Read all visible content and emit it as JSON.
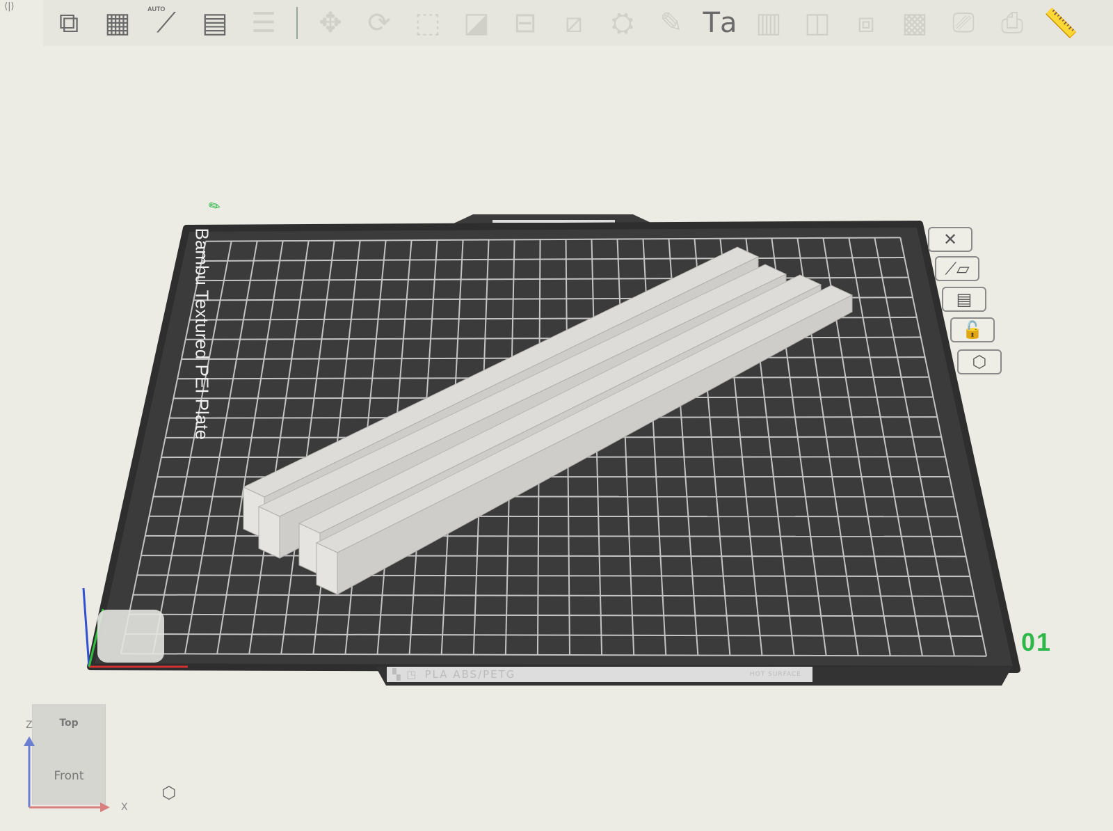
{
  "toolbar": {
    "collapse_icon": "collapse-icon",
    "main_tools": [
      {
        "name": "add-object",
        "glyph": "⧉"
      },
      {
        "name": "add-plate",
        "glyph": "▦"
      },
      {
        "name": "auto-orient",
        "glyph": "⟋",
        "label": "AUTO"
      },
      {
        "name": "arrange",
        "glyph": "▤"
      },
      {
        "name": "layers",
        "glyph": "☰"
      }
    ],
    "edit_tools": [
      {
        "name": "move",
        "glyph": "✥"
      },
      {
        "name": "rotate",
        "glyph": "⟳"
      },
      {
        "name": "scale",
        "glyph": "⬚"
      },
      {
        "name": "lay-on-face",
        "glyph": "◪"
      },
      {
        "name": "split",
        "glyph": "⊟"
      },
      {
        "name": "cut",
        "glyph": "⧄"
      },
      {
        "name": "paint-support",
        "glyph": "⛭"
      },
      {
        "name": "paint-seam",
        "glyph": "✎"
      },
      {
        "name": "text",
        "glyph": "Tа"
      },
      {
        "name": "measure-height",
        "glyph": "▥"
      },
      {
        "name": "variable-layer",
        "glyph": "◫"
      },
      {
        "name": "boolean",
        "glyph": "⧈"
      },
      {
        "name": "mesh-repair",
        "glyph": "▩"
      },
      {
        "name": "ooze-plate",
        "glyph": "⎚"
      },
      {
        "name": "part-plate",
        "glyph": "⎙"
      },
      {
        "name": "ruler",
        "glyph": "📏"
      }
    ]
  },
  "plate": {
    "label": "Bambu Textured PEI Plate",
    "number": "01",
    "strip_text": "PLA ABS/PETG",
    "hot_surface": "HOT SURFACE",
    "grid_cols": 27,
    "grid_rows": 21,
    "side_buttons": [
      {
        "name": "delete-plate",
        "glyph": "✕"
      },
      {
        "name": "auto-orient-plate",
        "glyph": "⟋▱"
      },
      {
        "name": "arrange-plate",
        "glyph": "▤"
      },
      {
        "name": "lock-plate",
        "glyph": "🔓"
      },
      {
        "name": "plate-settings",
        "glyph": "⬡"
      }
    ]
  },
  "view_cube": {
    "top": "Top",
    "front": "Front",
    "z_axis": "Z",
    "x_axis": "X"
  },
  "colors": {
    "accent": "#2fb84a",
    "plate": "#3b3b3b",
    "grid": "#bdbdbd",
    "model": "#d9d9d6"
  }
}
